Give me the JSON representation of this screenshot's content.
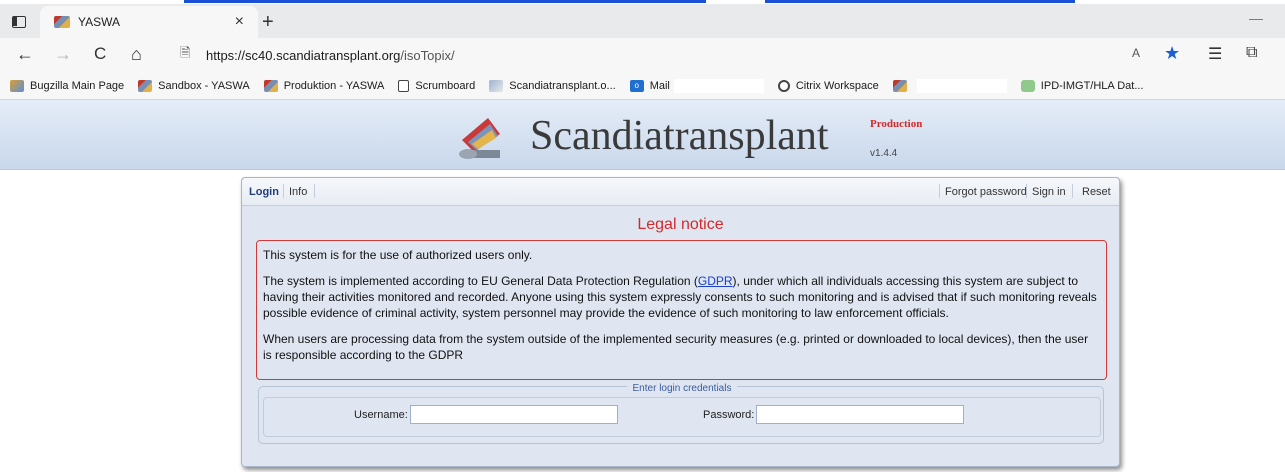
{
  "browser": {
    "tab": {
      "title": "YASWA",
      "close": "×"
    },
    "new_tab": "+",
    "minimize": "—",
    "nav": {
      "back": "←",
      "forward": "→",
      "reload": "C",
      "home": "⌂"
    },
    "address": {
      "host": "https://sc40.scandiatransplant.org",
      "path": "/isoTopix/"
    },
    "read_aloud": "A",
    "bookmarks": [
      {
        "label": "Bugzilla Main Page",
        "icon": "img"
      },
      {
        "label": "Sandbox - YASWA",
        "icon": "flag"
      },
      {
        "label": "Produktion - YASWA",
        "icon": "flag"
      },
      {
        "label": "Scrumboard",
        "icon": "page"
      },
      {
        "label": "Scandiatransplant.o...",
        "icon": "folder"
      },
      {
        "label": "Mail",
        "icon": "mail"
      },
      {
        "label": "Citrix Workspace",
        "icon": "citrix"
      },
      {
        "label": "",
        "icon": "flag"
      },
      {
        "label": "IPD-IMGT/HLA Dat...",
        "icon": "green"
      }
    ]
  },
  "site": {
    "brand": "Scandiatransplant",
    "environment": "Production",
    "version": "v1.4.4"
  },
  "panel": {
    "tabs_left": [
      "Login",
      "Info"
    ],
    "tabs_right": [
      "Forgot password",
      "Sign in",
      "Reset"
    ],
    "legal_title": "Legal notice",
    "legal": {
      "p1": "This system is for the use of authorized users only.",
      "p2_before": "The system is implemented according to EU General Data Protection Regulation (",
      "p2_link": "GDPR",
      "p2_after": "), under which all individuals accessing this system are subject to having their activities monitored and recorded. Anyone using this system expressly consents to such monitoring and is advised that if such monitoring reveals possible evidence of criminal activity, system personnel may provide the evidence of such monitoring to law enforcement officials.",
      "p3": "When users are processing data from the system outside of the implemented security measures (e.g. printed or downloaded to local devices), then the user is responsible according to the GDPR"
    },
    "credentials": {
      "legend": "Enter login credentials",
      "username_label": "Username:",
      "password_label": "Password:",
      "username_value": "",
      "password_value": ""
    }
  },
  "colors": {
    "accent_red": "#d12b2b",
    "link_blue": "#1a3fc9",
    "header_bg": "#c9d8ec",
    "panel_bg": "#dfe6f1"
  }
}
